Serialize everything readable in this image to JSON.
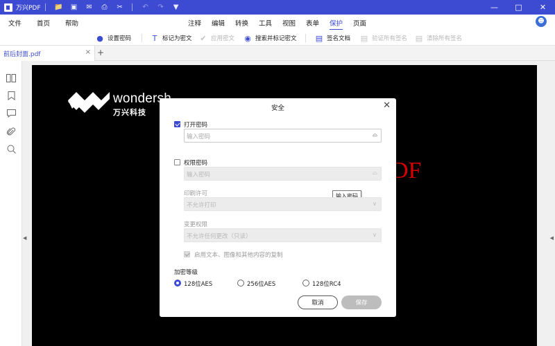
{
  "titlebar": {
    "app_title": "万兴PDF",
    "quick_icons": [
      "folder-icon",
      "save-icon",
      "mail-icon",
      "print-icon",
      "share-icon",
      "undo-icon",
      "redo-icon",
      "dropdown-icon"
    ],
    "window_controls": [
      "minimize-icon",
      "maximize-icon",
      "close-icon"
    ]
  },
  "menu": {
    "left": [
      "文件",
      "首页",
      "帮助"
    ],
    "tabs": [
      "注释",
      "编辑",
      "转换",
      "工具",
      "视图",
      "表单",
      "保护",
      "页面"
    ],
    "active_tab": "保护"
  },
  "ribbon": {
    "set_password": "设置密码",
    "mark_redact": "标记为密文",
    "apply_redact": "应用密文",
    "search_redact": "搜索并标记密文",
    "sign_doc": "签名文档",
    "verify_all": "验证所有签名",
    "clear_all": "清除所有签名"
  },
  "tabs": {
    "doc_name": "前后封面.pdf",
    "close": "×",
    "new": "+"
  },
  "page": {
    "brand_name": "wondersh",
    "brand_cn": "万兴科技",
    "red_text": "DF"
  },
  "dialog": {
    "title": "安全",
    "close": "✕",
    "open_password_label": "打开密码",
    "open_password_checked": true,
    "open_password_placeholder": "输入密码",
    "permission_password_label": "权限密码",
    "permission_password_checked": false,
    "permission_password_placeholder": "输入密码",
    "tooltip": "输入密码",
    "print_permission_label": "印刷许可",
    "print_permission_value": "不允许打印",
    "change_permission_label": "变更权限",
    "change_permission_value": "不允许任何更改（只读）",
    "copy_label": "启用文本、图像和其他内容的复制",
    "copy_checked": true,
    "encryption_label": "加密等级",
    "encryption_options": [
      "128位AES",
      "256位AES",
      "128位RC4"
    ],
    "encryption_selected": "128位AES",
    "cancel": "取消",
    "save": "保存"
  }
}
